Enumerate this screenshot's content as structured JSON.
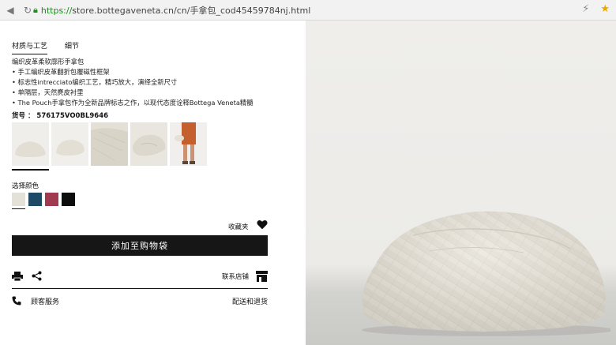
{
  "browser": {
    "url_scheme": "https://",
    "url_rest": "store.bottegaveneta.cn/cn/手拿包_cod45459784nj.html"
  },
  "tabs": [
    {
      "label": "材质与工艺",
      "active": true
    },
    {
      "label": "细节",
      "active": false
    }
  ],
  "description": {
    "title": "编织皮革柔软廓形手拿包",
    "bullets": [
      "手工编织皮革翻折包覆磁性框架",
      "标志性intrecciato编织工艺，精巧放大，演绎全新尺寸",
      "单隔层，天然麂皮衬里",
      "The Pouch手拿包作为全新品牌标志之作，以现代态度诠释Bottega Veneta精髓"
    ]
  },
  "sku": "货号 ： 576175VO0BL9646",
  "colors": {
    "label": "选择颜色",
    "swatches": [
      "#e4e1d8",
      "#1f4a66",
      "#a03a50",
      "#0d0d0d"
    ]
  },
  "favorites_label": "收藏夹",
  "add_to_bag_label": "添加至购物袋",
  "store_contact_label": "联系店铺",
  "footer": {
    "service_label": "顾客服务",
    "shipping_label": "配送和退货"
  }
}
